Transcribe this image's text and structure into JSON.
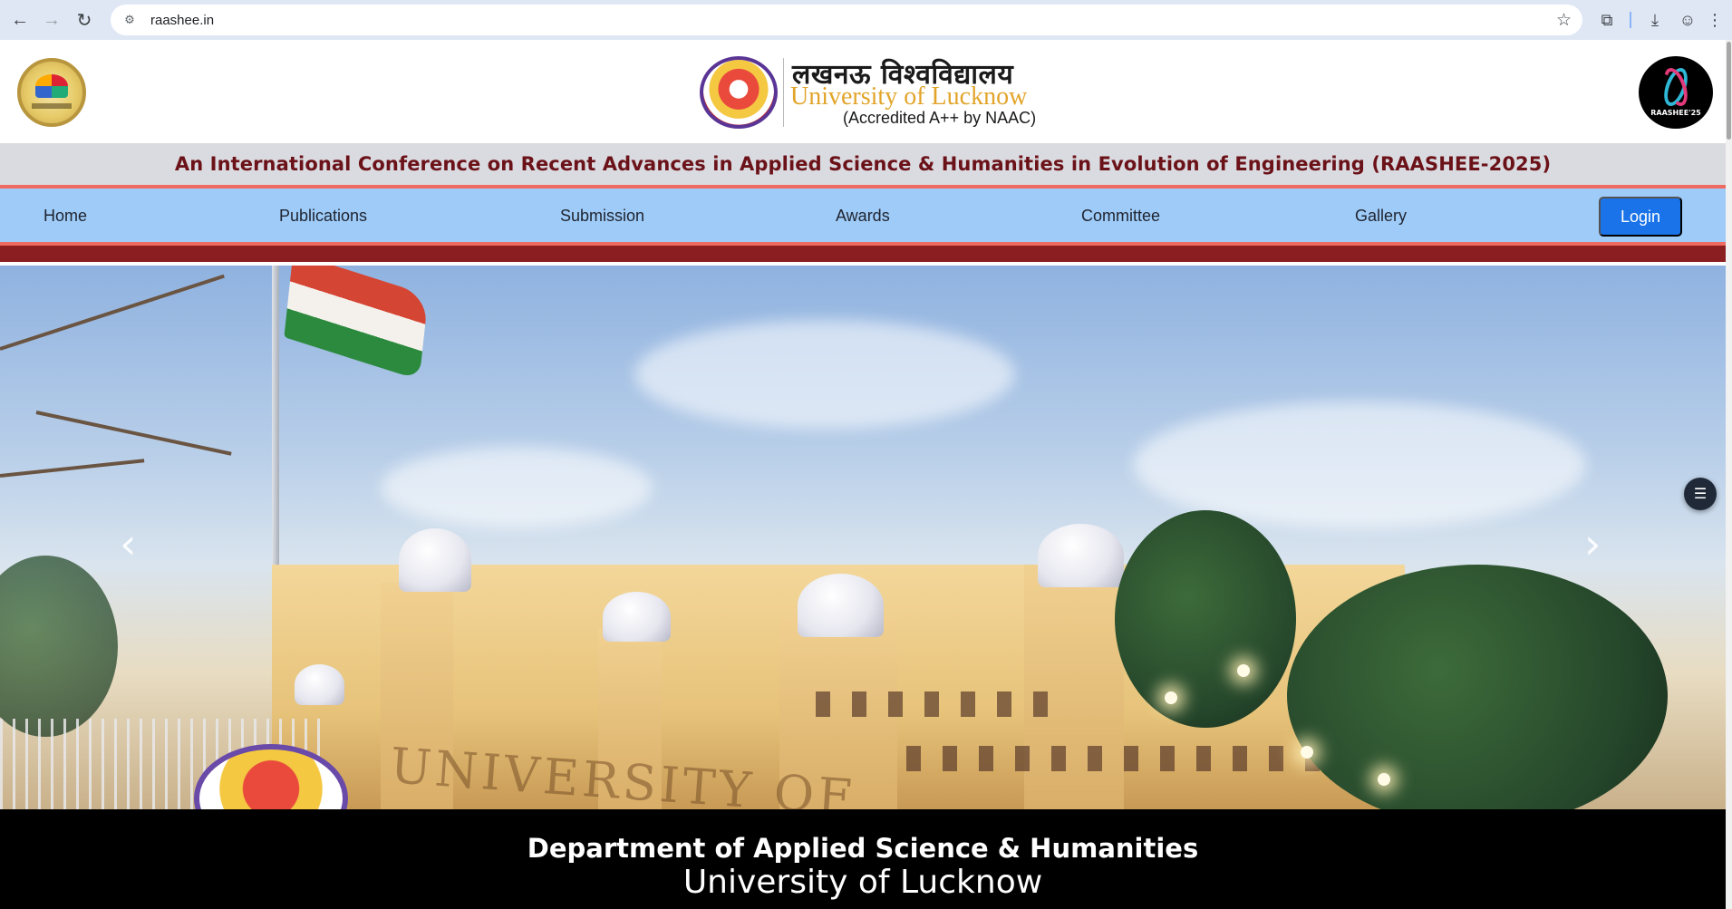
{
  "browser": {
    "url": "raashee.in",
    "back_icon": "arrow-left-icon",
    "forward_icon": "arrow-right-icon",
    "reload_icon": "reload-icon"
  },
  "header": {
    "university_hindi": "लखनऊ विश्वविद्यालय",
    "university_english": "University of Lucknow",
    "accreditation": "(Accredited A++ by NAAC)",
    "right_logo_text": "RAASHEE'25"
  },
  "conference": {
    "title": "An International Conference on Recent Advances in Applied Science & Humanities in Evolution of Engineering (RAASHEE-2025)"
  },
  "nav": {
    "items": [
      {
        "label": "Home"
      },
      {
        "label": "Publications"
      },
      {
        "label": "Submission"
      },
      {
        "label": "Awards"
      },
      {
        "label": "Committee"
      },
      {
        "label": "Gallery"
      }
    ],
    "login_label": "Login"
  },
  "hero": {
    "ground_text": "UNIVERSITY OF",
    "prev_arrow": "‹",
    "next_arrow": "›"
  },
  "footer": {
    "department": "Department of Applied Science & Humanities",
    "university": "University of Lucknow"
  },
  "colors": {
    "nav_background": "#9ecbf7",
    "accent_red": "#ef6b62",
    "maroon": "#8b1e20",
    "login_blue": "#1a73e8",
    "title_color": "#6b1219"
  }
}
